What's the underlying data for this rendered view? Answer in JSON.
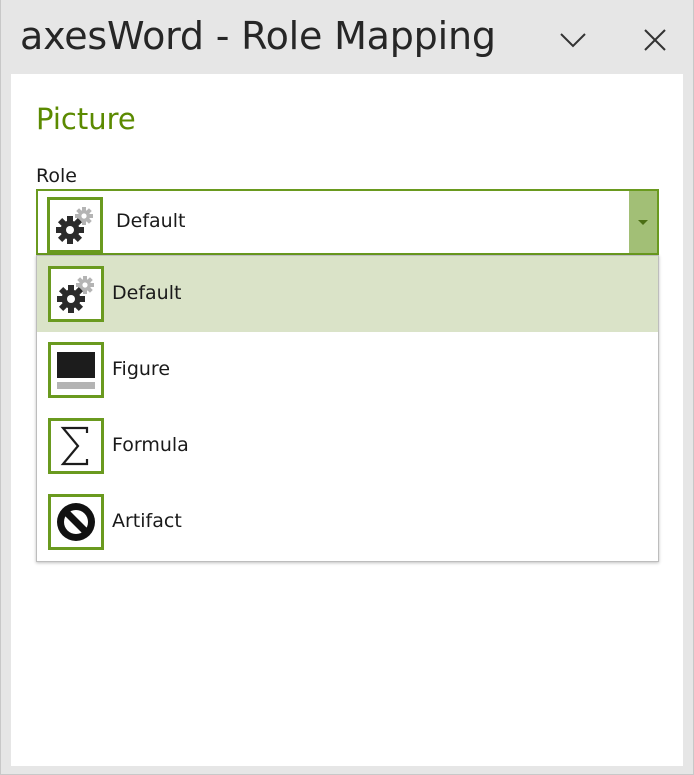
{
  "window": {
    "title": "axesWord - Role Mapping"
  },
  "section": {
    "title": "Picture"
  },
  "role": {
    "label": "Role",
    "selected": "Default",
    "selected_icon": "gears-icon"
  },
  "options": [
    {
      "label": "Default",
      "icon": "gears-icon",
      "selected": true
    },
    {
      "label": "Figure",
      "icon": "figure-icon",
      "selected": false
    },
    {
      "label": "Formula",
      "icon": "sigma-icon",
      "selected": false
    },
    {
      "label": "Artifact",
      "icon": "no-entry-icon",
      "selected": false
    }
  ],
  "colors": {
    "accent_green": "#5b8a00",
    "icon_border": "#6a9a1f",
    "selected_row": "#dae3c8",
    "dropdown_button": "#a2bf76"
  }
}
